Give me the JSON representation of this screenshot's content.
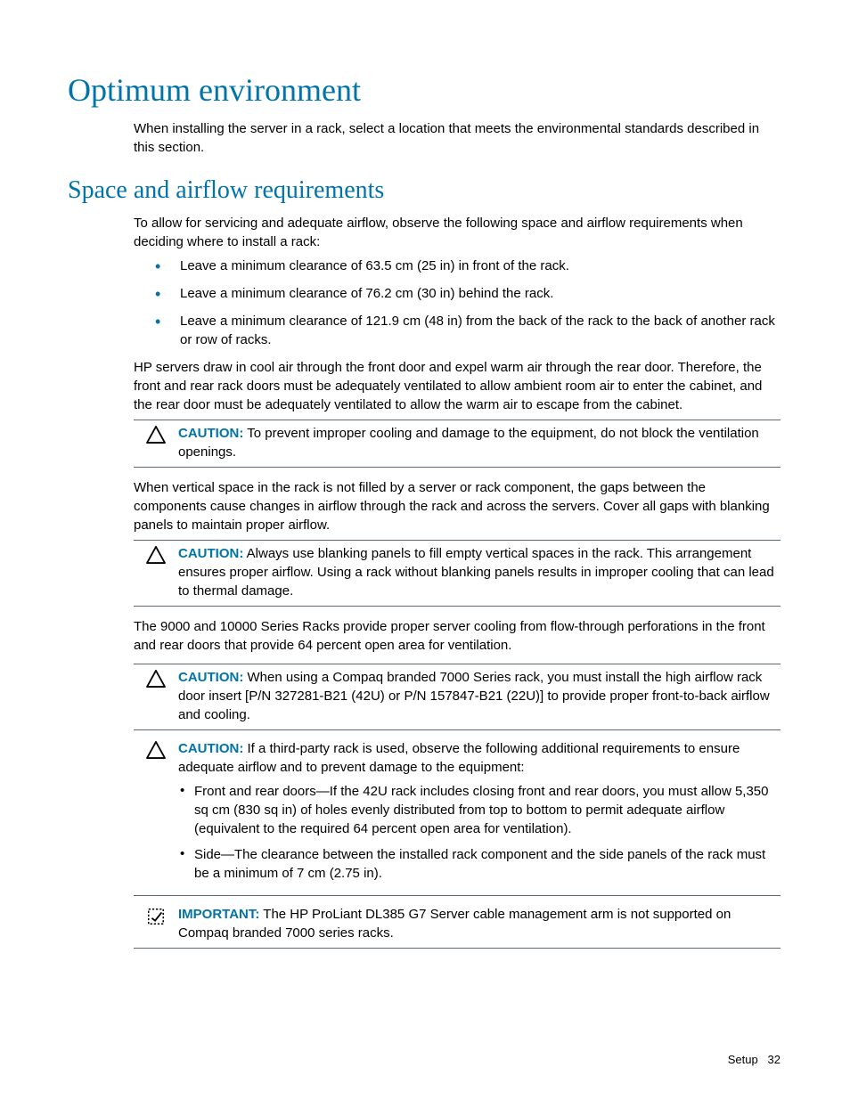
{
  "heading1": "Optimum environment",
  "intro1": "When installing the server in a rack, select a location that meets the environmental standards described in this section.",
  "heading2": "Space and airflow requirements",
  "intro2": "To allow for servicing and adequate airflow, observe the following space and airflow requirements when deciding where to install a rack:",
  "bullets": {
    "b1": "Leave a minimum clearance of 63.5 cm (25 in) in front of the rack.",
    "b2": "Leave a minimum clearance of 76.2 cm (30 in) behind the rack.",
    "b3": "Leave a minimum clearance of 121.9 cm (48 in) from the back of the rack to the back of another rack or row of racks."
  },
  "para_cooling": "HP servers draw in cool air through the front door and expel warm air through the rear door. Therefore, the front and rear rack doors must be adequately ventilated to allow ambient room air to enter the cabinet, and the rear door must be adequately ventilated to allow the warm air to escape from the cabinet.",
  "caution1_label": "CAUTION:",
  "caution1_text": "  To prevent improper cooling and damage to the equipment, do not block the ventilation openings.",
  "para_gaps": "When vertical space in the rack is not filled by a server or rack component, the gaps between the components cause changes in airflow through the rack and across the servers. Cover all gaps with blanking panels to maintain proper airflow.",
  "caution2_label": "CAUTION:",
  "caution2_text": "  Always use blanking panels to fill empty vertical spaces in the rack. This arrangement ensures proper airflow. Using a rack without blanking panels results in improper cooling that can lead to thermal damage.",
  "para_9000": "The 9000 and 10000 Series Racks provide proper server cooling from flow-through perforations in the front and rear doors that provide 64 percent open area for ventilation.",
  "caution3_label": "CAUTION:",
  "caution3_text": "  When using a Compaq branded 7000 Series rack, you must install the high airflow rack door insert [P/N 327281-B21 (42U) or P/N 157847-B21 (22U)] to provide proper front-to-back airflow and cooling.",
  "caution4_label": "CAUTION:",
  "caution4_text": "  If a third-party rack is used, observe the following additional requirements to ensure adequate airflow and to prevent damage to the equipment:",
  "caution4_items": {
    "i1": "Front and rear doors—If the 42U rack includes closing front and rear doors, you must allow 5,350 sq cm (830 sq in) of holes evenly distributed from top to bottom to permit adequate airflow (equivalent to the required 64 percent open area for ventilation).",
    "i2": "Side—The clearance between the installed rack component and the side panels of the rack must be a minimum of 7 cm (2.75 in)."
  },
  "important_label": "IMPORTANT:",
  "important_text": "  The HP ProLiant DL385 G7 Server cable management arm is not supported on Compaq branded 7000 series racks.",
  "footer_section": "Setup",
  "footer_page": "32"
}
